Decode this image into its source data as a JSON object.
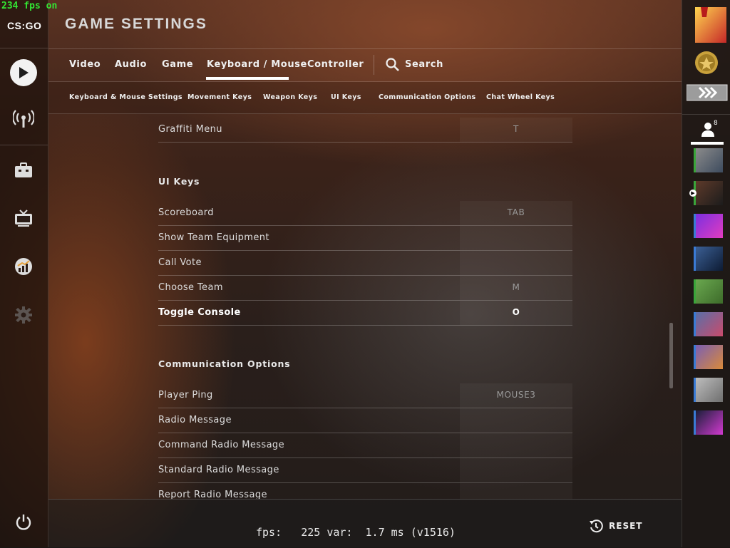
{
  "overlay": {
    "fps_top": "234 fps on"
  },
  "sidebar": {
    "logo_text": "CS:GO",
    "items": [
      {
        "icon": "play-icon",
        "label": "Play"
      },
      {
        "icon": "broadcast-icon",
        "label": "Watch"
      },
      {
        "icon": "briefcase-icon",
        "label": "Inventory"
      },
      {
        "icon": "tv-icon",
        "label": "Watch TV"
      },
      {
        "icon": "stats-icon",
        "label": "Stats"
      },
      {
        "icon": "gear-icon",
        "label": "Settings"
      },
      {
        "icon": "power-icon",
        "label": "Quit"
      }
    ]
  },
  "header": {
    "title": "GAME SETTINGS"
  },
  "tabs": [
    {
      "label": "Video"
    },
    {
      "label": "Audio"
    },
    {
      "label": "Game"
    },
    {
      "label": "Keyboard / Mouse",
      "active": true
    },
    {
      "label": "Controller"
    }
  ],
  "search": {
    "label": "Search"
  },
  "subtabs": [
    {
      "label": "Keyboard & Mouse Settings"
    },
    {
      "label": "Movement Keys"
    },
    {
      "label": "Weapon Keys"
    },
    {
      "label": "UI Keys"
    },
    {
      "label": "Communication Options"
    },
    {
      "label": "Chat Wheel Keys"
    }
  ],
  "content": {
    "rows_top": [
      {
        "label": "Graffiti Menu",
        "key": "T"
      }
    ],
    "ui_keys": {
      "heading": "UI Keys",
      "rows": [
        {
          "label": "Scoreboard",
          "key": "TAB"
        },
        {
          "label": "Show Team Equipment",
          "key": ""
        },
        {
          "label": "Call Vote",
          "key": ""
        },
        {
          "label": "Choose Team",
          "key": "M"
        },
        {
          "label": "Toggle Console",
          "key": "O",
          "highlight": true
        }
      ]
    },
    "communication": {
      "heading": "Communication Options",
      "rows": [
        {
          "label": "Player Ping",
          "key": "MOUSE3"
        },
        {
          "label": "Radio Message",
          "key": ""
        },
        {
          "label": "Command Radio Message",
          "key": ""
        },
        {
          "label": "Standard Radio Message",
          "key": ""
        },
        {
          "label": "Report Radio Message",
          "key": ""
        }
      ]
    }
  },
  "footer": {
    "fps_text": "fps:   225 var:  1.7 ms (v1516)",
    "reset_label": "RESET"
  },
  "right_sidebar": {
    "friends_count": "8",
    "colors": {
      "online_bar": "#3aa53a"
    }
  }
}
